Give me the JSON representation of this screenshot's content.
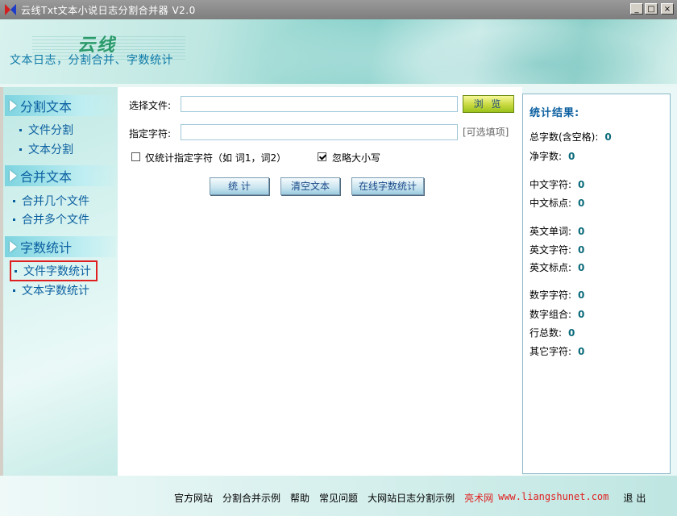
{
  "window": {
    "title": "云线Txt文本小说日志分割合并器 V2.0",
    "controls": [
      "_",
      "□",
      "×"
    ]
  },
  "banner": {
    "brand": "云线",
    "subtitle": "文本日志，分割合并、字数统计"
  },
  "sidebar": {
    "sections": [
      {
        "title": "分割文本",
        "items": [
          "文件分割",
          "文本分割"
        ]
      },
      {
        "title": "合并文本",
        "items": [
          "合并几个文件",
          "合并多个文件"
        ]
      },
      {
        "title": "字数统计",
        "items": [
          "文件字数统计",
          "文本字数统计"
        ]
      }
    ],
    "selected_item": "文件字数统计"
  },
  "form": {
    "file_label": "选择文件:",
    "file_value": "",
    "browse_label": "浏 览",
    "chars_label": "指定字符:",
    "chars_value": "",
    "chars_hint": "[可选填项]",
    "only_specified_label": "仅统计指定字符（如 词1，词2）",
    "only_specified_checked": false,
    "ignore_case_label": "忽略大小写",
    "ignore_case_checked": true
  },
  "actions": {
    "count_label": "统 计",
    "clear_label": "清空文本",
    "online_label": "在线字数统计"
  },
  "stats": {
    "title": "统计结果:",
    "items": [
      {
        "label": "总字数(含空格):",
        "value": "0"
      },
      {
        "label": "净字数:",
        "value": "0"
      },
      {
        "label": "中文字符:",
        "value": "0"
      },
      {
        "label": "中文标点:",
        "value": "0"
      },
      {
        "label": "英文单词:",
        "value": "0"
      },
      {
        "label": "英文字符:",
        "value": "0"
      },
      {
        "label": "英文标点:",
        "value": "0"
      },
      {
        "label": "数字字符:",
        "value": "0"
      },
      {
        "label": "数字组合:",
        "value": "0"
      },
      {
        "label": "行总数:",
        "value": "0"
      },
      {
        "label": "其它字符:",
        "value": "0"
      }
    ]
  },
  "footer": {
    "links": [
      "官方网站",
      "分割合并示例",
      "帮助",
      "常见问题",
      "大网站日志分割示例"
    ],
    "brand": "亮术网",
    "url": "www.liangshunet.com",
    "exit": "退出"
  },
  "colors": {
    "accent": "#0a5fa0",
    "selected_outline": "#e02020",
    "browse_button": "#c8d840",
    "footer_brand": "#e02020"
  }
}
